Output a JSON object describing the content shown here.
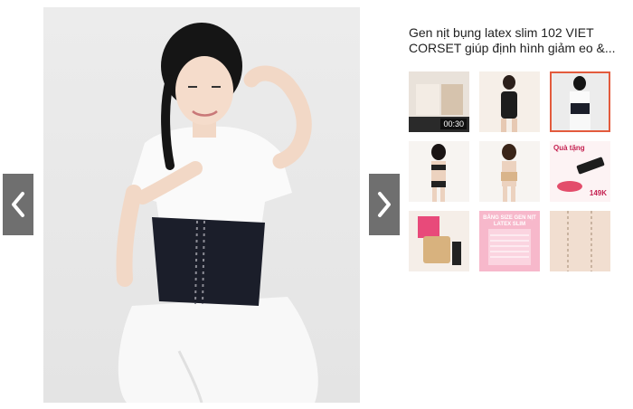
{
  "product": {
    "title": "Gen nịt bụng latex slim 102 VIET CORSET giúp định hình giảm eo &..."
  },
  "gallery": {
    "main_alt": "Model wearing black latex waist corset",
    "prev_icon": "chevron-left-icon",
    "next_icon": "chevron-right-icon",
    "thumbnails": [
      {
        "kind": "video",
        "duration": "00:30",
        "selected": false
      },
      {
        "kind": "image",
        "selected": false
      },
      {
        "kind": "image",
        "selected": true
      },
      {
        "kind": "image",
        "selected": false
      },
      {
        "kind": "image",
        "selected": false
      },
      {
        "kind": "image",
        "promo_text": "Quà tặng",
        "price": "149K",
        "selected": false
      },
      {
        "kind": "image",
        "selected": false
      },
      {
        "kind": "image",
        "header": "BẢNG SIZE GEN NỊT",
        "subheader": "LATEX SLIM",
        "selected": false
      },
      {
        "kind": "image",
        "selected": false
      }
    ]
  },
  "colors": {
    "accent": "#e35b3d",
    "nav_bg": "#6f6f6f"
  }
}
